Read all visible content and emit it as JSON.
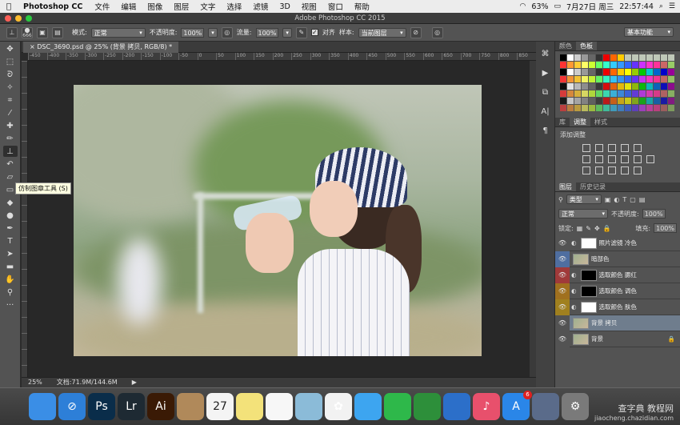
{
  "menubar": {
    "app_name": "Photoshop CC",
    "items": [
      "文件",
      "编辑",
      "图像",
      "图层",
      "文字",
      "选择",
      "滤镜",
      "3D",
      "视图",
      "窗口",
      "帮助"
    ],
    "battery": "63%",
    "date": "7月27日 周三",
    "time": "22:57:44"
  },
  "window": {
    "title": "Adobe Photoshop CC 2015"
  },
  "options": {
    "brush_size": "666",
    "mode_label": "模式:",
    "mode_value": "正常",
    "opacity_label": "不透明度:",
    "opacity_value": "100%",
    "flow_label": "流量:",
    "flow_value": "100%",
    "align_label": "对齐",
    "sample_label": "样本:",
    "sample_value": "当前图层",
    "workspace": "基本功能"
  },
  "document": {
    "tab_title": "DSC_3690.psd @ 25% (背景 拷贝, RGB/8) *",
    "ruler_ticks": [
      "-450",
      "-400",
      "-350",
      "-300",
      "-250",
      "-200",
      "-150",
      "-100",
      "-50",
      "0",
      "50",
      "100",
      "150",
      "200",
      "250",
      "300",
      "350",
      "400",
      "450",
      "500",
      "550",
      "600",
      "650",
      "700",
      "750",
      "800",
      "850"
    ],
    "zoom": "25%",
    "doc_info": "文档:71.9M/144.6M"
  },
  "tooltip": "仿制图章工具 (S)",
  "panels": {
    "color_tabs": [
      "颜色",
      "色板"
    ],
    "adjust_tabs": [
      "库",
      "调整",
      "样式"
    ],
    "adjust_title": "添加调整",
    "layers_tabs": [
      "图层",
      "历史记录"
    ],
    "kind_label": "类型",
    "blend_mode": "正常",
    "opacity_label": "不透明度:",
    "opacity_value": "100%",
    "lock_label": "锁定:",
    "fill_label": "填充:",
    "fill_value": "100%",
    "layers": [
      {
        "name": "照片滤镜 冷色",
        "color": "#535353",
        "mask": "#ffffff"
      },
      {
        "name": "暗部色",
        "color": "#4f6ea0",
        "mask": "none"
      },
      {
        "name": "选取颜色 腮红",
        "color": "#a03a3a",
        "mask": "#000000"
      },
      {
        "name": "选取颜色 调色",
        "color": "#a0701f",
        "mask": "#000000"
      },
      {
        "name": "选取颜色 肤色",
        "color": "#a0801f",
        "mask": "#ffffff"
      },
      {
        "name": "背景 拷贝",
        "color": "#535353",
        "mask": "none",
        "selected": true
      },
      {
        "name": "背景",
        "color": "#535353",
        "mask": "none",
        "locked": true
      }
    ]
  },
  "dock": {
    "apps": [
      {
        "name": "finder-icon",
        "label": "",
        "color": "#3a8ee6"
      },
      {
        "name": "safari-icon",
        "label": "⊘",
        "color": "#2d7fd8"
      },
      {
        "name": "photoshop-icon",
        "label": "Ps",
        "color": "#0a2d4a"
      },
      {
        "name": "lightroom-icon",
        "label": "Lr",
        "color": "#1e2a33"
      },
      {
        "name": "illustrator-icon",
        "label": "Ai",
        "color": "#3a1a05"
      },
      {
        "name": "contacts-icon",
        "label": "",
        "color": "#b0895a"
      },
      {
        "name": "calendar-icon",
        "label": "27",
        "color": "#f4f4f4"
      },
      {
        "name": "notes-icon",
        "label": "",
        "color": "#f3e27a"
      },
      {
        "name": "reminders-icon",
        "label": "",
        "color": "#f7f7f7"
      },
      {
        "name": "preview-icon",
        "label": "",
        "color": "#8bbbd8"
      },
      {
        "name": "photos-icon",
        "label": "✿",
        "color": "#f2f2f2"
      },
      {
        "name": "messages-icon",
        "label": "",
        "color": "#3da5f0"
      },
      {
        "name": "facetime-icon",
        "label": "",
        "color": "#2eb84a"
      },
      {
        "name": "numbers-icon",
        "label": "",
        "color": "#2d8f3a"
      },
      {
        "name": "keynote-icon",
        "label": "",
        "color": "#2c6fc9"
      },
      {
        "name": "itunes-icon",
        "label": "♪",
        "color": "#e8506c"
      },
      {
        "name": "appstore-icon",
        "label": "A",
        "color": "#2a86e8",
        "badge": "6"
      },
      {
        "name": "launchpad-icon",
        "label": "",
        "color": "#5a6b8a"
      },
      {
        "name": "system-preferences-icon",
        "label": "⚙",
        "color": "#7a7a7a"
      }
    ]
  },
  "watermark": {
    "line1": "查字典 教程网",
    "line2": "jiaocheng.chazidian.com"
  }
}
